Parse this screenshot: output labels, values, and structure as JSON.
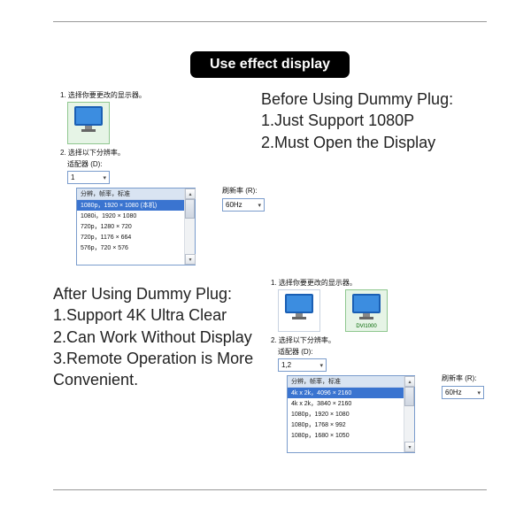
{
  "banner": "Use effect display",
  "captions": {
    "before": "Before Using Dummy Plug:\n1.Just Support 1080P\n2.Must Open the Display",
    "after": "After Using Dummy Plug:\n1.Support 4K Ultra Clear\n2.Can Work Without Display\n3.Remote Operation is More Convenient."
  },
  "dialog": {
    "step1": "1. 选择你要更改的显示器。",
    "step2": "2. 选择以下分辨率。",
    "adapter_label": "适配器 (D):",
    "adapter_single": "1",
    "adapter_multi": "1,2",
    "refresh_label": "刷新率 (R):",
    "refresh_value": "60Hz",
    "list_header": "分辨，帧率，标准",
    "monitor_caption": "DVI1000"
  },
  "before_list": {
    "selected": "1080p，1920 × 1080 (本机)",
    "items": [
      "1080i，1920 × 1080",
      "720p，1280 × 720",
      "720p，1176 × 664",
      "576p，720 × 576"
    ]
  },
  "after_list": {
    "selected": "4k x 2k，4096 × 2160",
    "items": [
      "4k x 2k，3840 × 2160",
      "1080p，1920 × 1080",
      "1080p，1768 × 992",
      "1080p，1680 × 1050"
    ]
  }
}
